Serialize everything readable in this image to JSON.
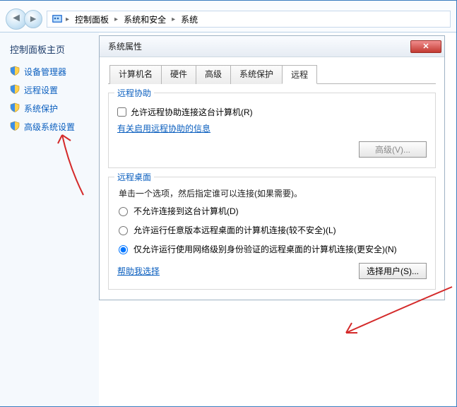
{
  "breadcrumbs": [
    "控制面板",
    "系统和安全",
    "系统"
  ],
  "sidebar": {
    "title": "控制面板主页",
    "items": [
      {
        "label": "设备管理器"
      },
      {
        "label": "远程设置"
      },
      {
        "label": "系统保护"
      },
      {
        "label": "高级系统设置"
      }
    ]
  },
  "dialog": {
    "title": "系统属性",
    "tabs": [
      {
        "label": "计算机名"
      },
      {
        "label": "硬件"
      },
      {
        "label": "高级"
      },
      {
        "label": "系统保护"
      },
      {
        "label": "远程"
      }
    ],
    "remoteAssist": {
      "group_title": "远程协助",
      "checkbox_label": "允许远程协助连接这台计算机(R)",
      "help_link": "有关启用远程协助的信息",
      "advanced_btn": "高级(V)..."
    },
    "remoteDesktop": {
      "group_title": "远程桌面",
      "desc": "单击一个选项，然后指定谁可以连接(如果需要)。",
      "options": [
        "不允许连接到这台计算机(D)",
        "允许运行任意版本远程桌面的计算机连接(较不安全)(L)",
        "仅允许运行使用网络级别身份验证的远程桌面的计算机连接(更安全)(N)"
      ],
      "help_link": "帮助我选择",
      "select_users_btn": "选择用户(S)..."
    }
  }
}
